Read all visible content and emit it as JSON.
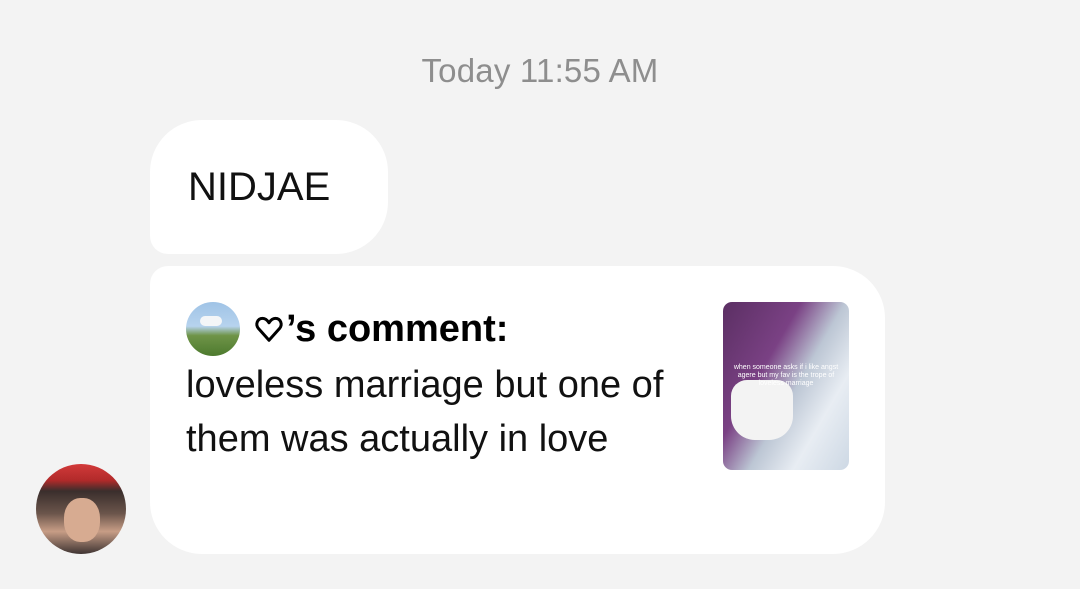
{
  "timestamp": "Today 11:55 AM",
  "messages": [
    {
      "text": "NIDJAE"
    }
  ],
  "shared_comment": {
    "author_suffix": "’s comment:",
    "body": "loveless marriage but one of them was actually in love",
    "thumbnail_caption": "when someone asks if i like angst agere but my fav is the trope of loveless marriage"
  }
}
